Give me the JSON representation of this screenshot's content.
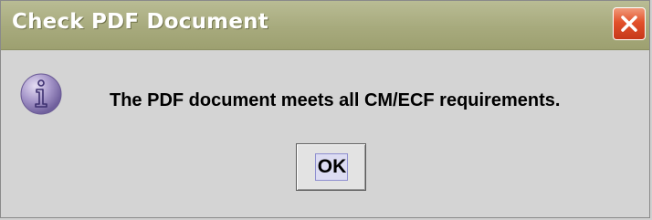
{
  "window": {
    "title": "Check PDF Document",
    "close_icon": "close-icon",
    "close_color": "#e2512b",
    "titlebar_color": "#a7aa7d"
  },
  "dialog": {
    "icon": "info-icon",
    "message": "The PDF document meets all CM/ECF requirements.",
    "ok_label": "OK"
  }
}
